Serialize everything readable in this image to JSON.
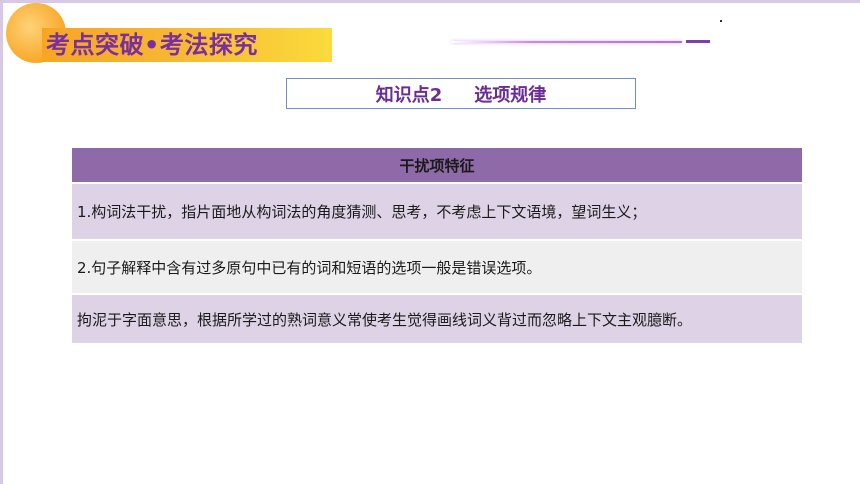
{
  "header": {
    "title": "考点突破•考法探究"
  },
  "section": {
    "label": "知识点2",
    "title": "选项规律"
  },
  "table": {
    "header": "干扰项特征",
    "rows": [
      "1.构词法干扰，指片面地从构词法的角度猜测、思考，不考虑上下文语境，望词生义；",
      "2.句子解释中含有过多原句中已有的词和短语的选项一般是错误选项。",
      "拘泥于字面意思，根据所学过的熟词意义常使考生觉得画线词义背过而忽略上下文主观臆断。"
    ]
  },
  "colors": {
    "title_text": "#7a2fa0",
    "title_band": "#f7b733",
    "table_header_bg": "#8f6aa8",
    "row_purple_bg": "#ddd2e6",
    "row_gray_bg": "#efefef",
    "section_border": "#6d8fc8"
  }
}
